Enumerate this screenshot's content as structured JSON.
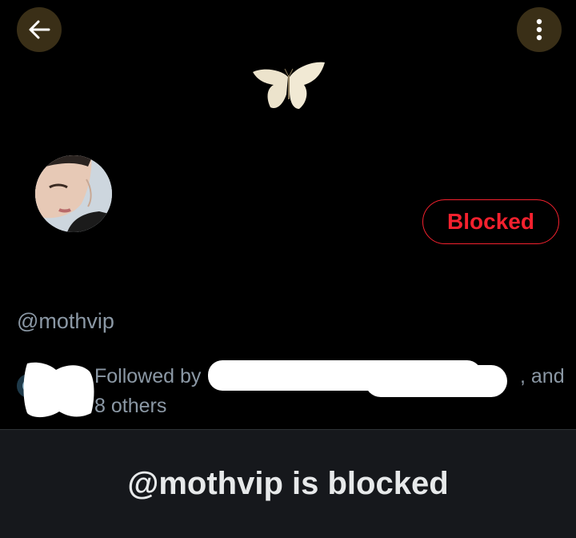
{
  "header": {
    "back_icon": "arrow-left-icon",
    "more_icon": "vertical-ellipsis-icon",
    "button_bg": "#3a2f17"
  },
  "banner": {
    "image": "butterfly-icon"
  },
  "profile": {
    "handle": "@mothvip",
    "blocked_button_label": "Blocked",
    "blocked_color": "#f4212e"
  },
  "followed_by": {
    "prefix": "Followed by",
    "suffix": ", and",
    "others": "8 others"
  },
  "blocked_notice": {
    "title": "@mothvip is blocked"
  }
}
